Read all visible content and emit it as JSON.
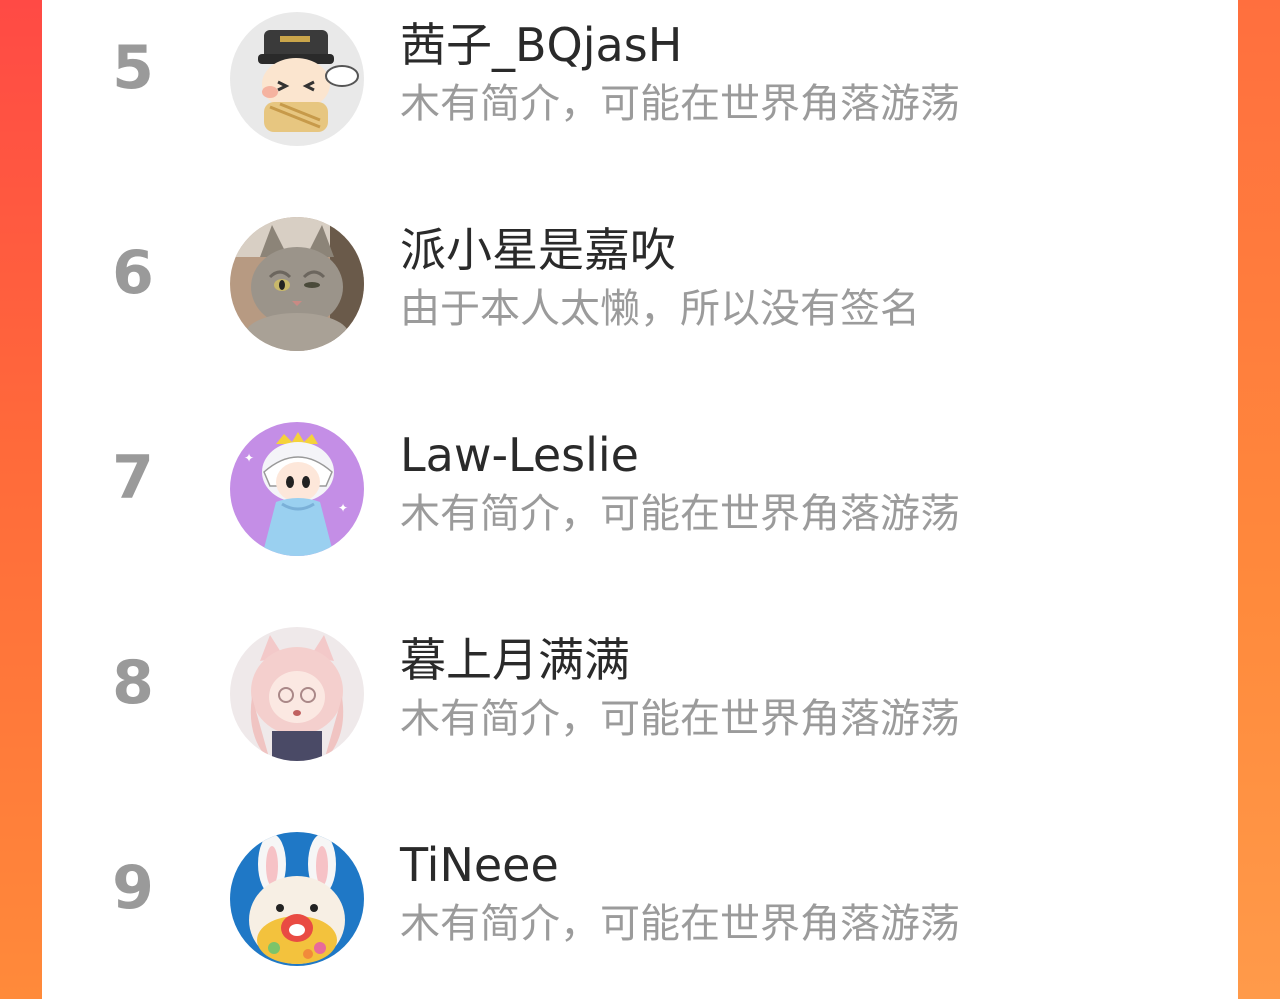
{
  "ranking_list": {
    "rows": [
      {
        "rank": "5",
        "name": "茜子_BQjasH",
        "bio": "木有简介，可能在世界角落游荡",
        "avatar": "soldier-cartoon-avatar"
      },
      {
        "rank": "6",
        "name": "派小星是嘉吹",
        "bio": "由于本人太懒，所以没有签名",
        "avatar": "gray-cat-avatar"
      },
      {
        "rank": "7",
        "name": "Law-Leslie",
        "bio": "木有简介，可能在世界角落游荡",
        "avatar": "anime-prince-avatar"
      },
      {
        "rank": "8",
        "name": "暮上月满满",
        "bio": "木有简介，可能在世界角落游荡",
        "avatar": "anime-catgirl-avatar"
      },
      {
        "rank": "9",
        "name": "TiNeee",
        "bio": "木有简介，可能在世界角落游荡",
        "avatar": "white-rabbit-plush-avatar"
      }
    ]
  },
  "colors": {
    "background_accent": "#ff5a40",
    "panel": "#ffffff",
    "rank_text": "#9a9a9a",
    "name_text": "#2a2a2a",
    "bio_text": "#9b9b9b"
  }
}
